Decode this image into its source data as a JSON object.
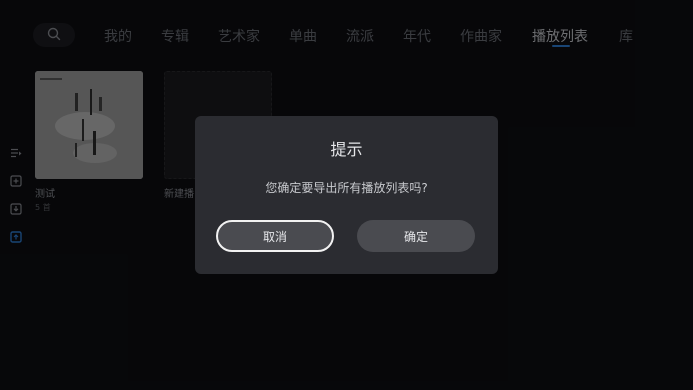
{
  "nav": {
    "search_icon": "search-icon",
    "items": [
      {
        "label": "我的"
      },
      {
        "label": "专辑"
      },
      {
        "label": "艺术家"
      },
      {
        "label": "单曲"
      },
      {
        "label": "流派"
      },
      {
        "label": "年代"
      },
      {
        "label": "作曲家"
      },
      {
        "label": "播放列表"
      },
      {
        "label": "库"
      }
    ],
    "active_index": 7,
    "accent_color": "#2f7fd6"
  },
  "side_icons": [
    "playlist-icon",
    "add-box-icon",
    "import-icon",
    "export-icon"
  ],
  "playlists": [
    {
      "title": "测试",
      "subtitle": "5 首"
    },
    {
      "title": "新建播"
    }
  ],
  "dialog": {
    "title": "提示",
    "message": "您确定要导出所有播放列表吗?",
    "cancel_label": "取消",
    "confirm_label": "确定"
  }
}
